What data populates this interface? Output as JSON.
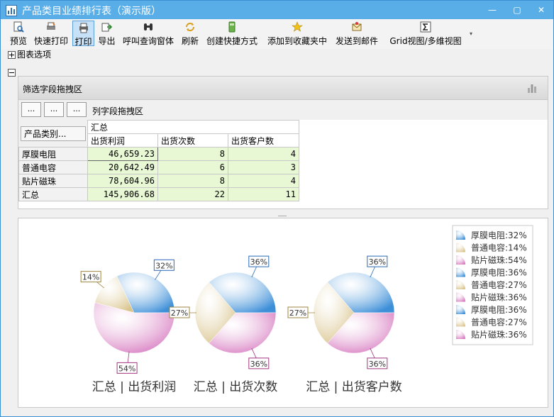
{
  "window": {
    "title": "产品类目业绩排行表（演示版）",
    "buttons": [
      "—",
      "▢",
      "✕"
    ]
  },
  "toolbar": {
    "items": [
      {
        "label": "预览",
        "icon": "preview-icon"
      },
      {
        "label": "快速打印",
        "icon": "quick-print-icon"
      },
      {
        "label": "打印",
        "icon": "print-icon",
        "active": true
      },
      {
        "label": "导出",
        "icon": "export-icon"
      },
      {
        "label": "呼叫查询窗体",
        "icon": "binoculars-icon"
      },
      {
        "label": "刷新",
        "icon": "refresh-icon"
      },
      {
        "label": "创建快捷方式",
        "icon": "shortcut-icon"
      },
      {
        "label": "添加到收藏夹中",
        "icon": "star-icon"
      },
      {
        "label": "发送到邮件",
        "icon": "mail-icon"
      },
      {
        "label": "Grid视图/多维视图",
        "icon": "sigma-icon"
      }
    ],
    "more": "▾"
  },
  "options": {
    "chart_options_label": "图表选项"
  },
  "pivot": {
    "filter_label": "筛选字段拖拽区",
    "col_area_label": "列字段拖拽区",
    "dots_label": "...",
    "row_field_label": "产品类别...",
    "group_header": "汇总",
    "columns": [
      "出货利润",
      "出货次数",
      "出货客户数"
    ],
    "rows": [
      {
        "name": "厚膜电阻",
        "values": [
          "46,659.23",
          "8",
          "4"
        ]
      },
      {
        "name": "普通电容",
        "values": [
          "20,642.49",
          "6",
          "3"
        ]
      },
      {
        "name": "贴片磁珠",
        "values": [
          "78,604.96",
          "8",
          "4"
        ]
      },
      {
        "name": "汇总",
        "values": [
          "145,906.68",
          "22",
          "11"
        ]
      }
    ]
  },
  "chart_data": {
    "type": "pie",
    "charts": [
      {
        "title": "汇总 | 出货利润",
        "categories": [
          "厚膜电阻",
          "普通电容",
          "贴片磁珠"
        ],
        "values": [
          32,
          14,
          54
        ],
        "labels": [
          "32%",
          "14%",
          "54%"
        ]
      },
      {
        "title": "汇总 | 出货次数",
        "categories": [
          "厚膜电阻",
          "普通电容",
          "贴片磁珠"
        ],
        "values": [
          36,
          27,
          36
        ],
        "labels": [
          "36%",
          "27%",
          "36%"
        ]
      },
      {
        "title": "汇总 | 出货客户数",
        "categories": [
          "厚膜电阻",
          "普通电容",
          "贴片磁珠"
        ],
        "values": [
          36,
          27,
          36
        ],
        "labels": [
          "36%",
          "27%",
          "36%"
        ]
      }
    ],
    "legend": [
      "厚膜电阻:32%",
      "普通电容:14%",
      "贴片磁珠:54%",
      "厚膜电阻:36%",
      "普通电容:27%",
      "贴片磁珠:36%",
      "厚膜电阻:36%",
      "普通电容:27%",
      "贴片磁珠:36%"
    ],
    "legend_position": "top-right",
    "colors": {
      "厚膜电阻": "#3d8fd8",
      "普通电容": "#d9c48c",
      "贴片磁珠": "#d77ac0"
    },
    "label_border_colors": {
      "厚膜电阻": "#2a6ab5",
      "普通电容": "#9c8540",
      "贴片磁珠": "#a2367f"
    }
  }
}
